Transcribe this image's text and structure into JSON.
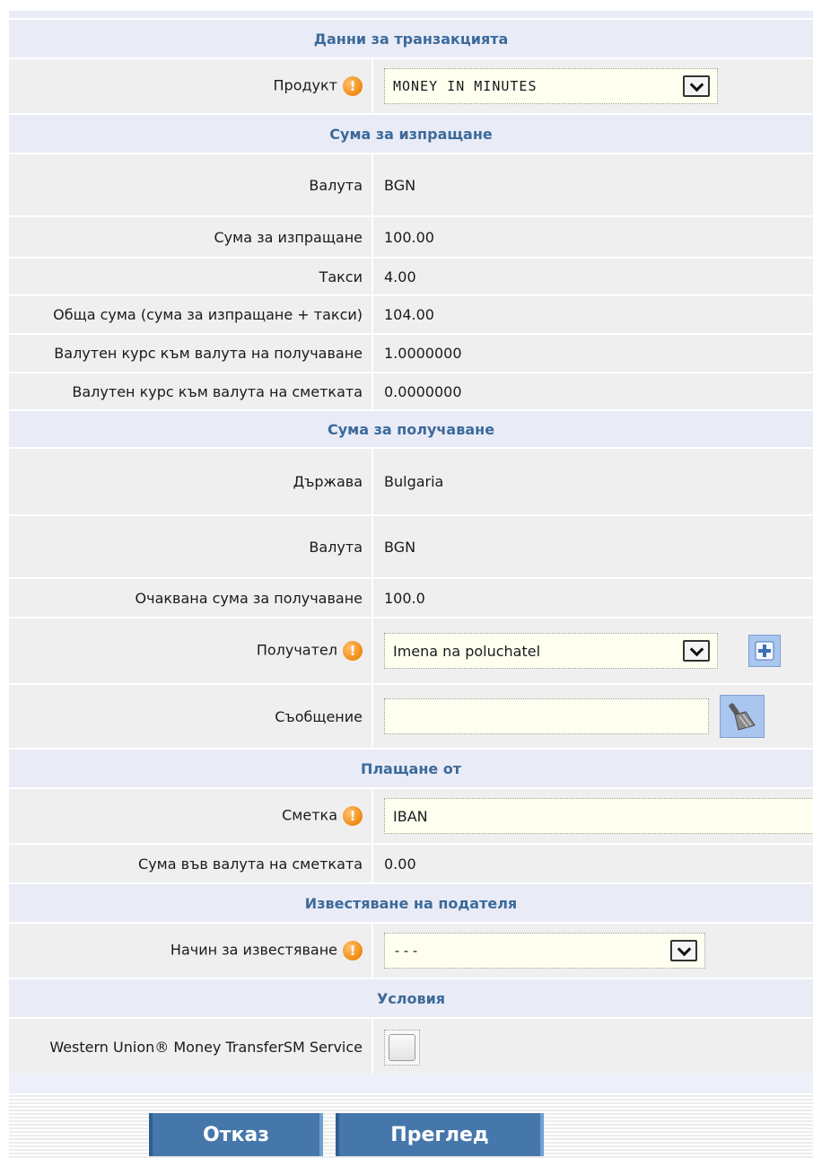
{
  "sections": {
    "transaction": "Данни за транзакцията",
    "send_amount": "Сума за изпращане",
    "receive_amount": "Сума за получаване",
    "payment_from": "Плащане от",
    "sender_notification": "Известяване на подателя",
    "terms": "Условия"
  },
  "transaction": {
    "product_label": "Продукт",
    "product_value": "MONEY IN MINUTES"
  },
  "send": {
    "currency_label": "Валута",
    "currency_value": "BGN",
    "amount_label": "Сума за изпращане",
    "amount_value": "100.00",
    "fees_label": "Такси",
    "fees_value": "4.00",
    "total_label": "Обща сума (сума за изпращане + такси)",
    "total_value": "104.00",
    "rate_receive_label": "Валутен курс към валута на получаване",
    "rate_receive_value": "1.0000000",
    "rate_account_label": "Валутен курс към валута на сметката",
    "rate_account_value": "0.0000000"
  },
  "receive": {
    "country_label": "Държава",
    "country_value": "Bulgaria",
    "currency_label": "Валута",
    "currency_value": "BGN",
    "expected_label": "Очаквана сума за получаване",
    "expected_value": "100.0",
    "recipient_label": "Получател",
    "recipient_value": "Imena na poluchatel",
    "message_label": "Съобщение",
    "message_value": ""
  },
  "payment": {
    "account_label": "Сметка",
    "account_value": "IBAN",
    "account_currency_label": "Сума във валута на сметката",
    "account_currency_value": "0.00"
  },
  "notification": {
    "method_label": "Начин за известяване",
    "method_value": "---"
  },
  "terms": {
    "service_label": "Western Union® Money TransferSM Service"
  },
  "icons": {
    "warning": "warning-icon",
    "add": "plus-icon",
    "clear": "broom-icon",
    "dropdown": "chevron-down-icon"
  },
  "colors": {
    "section_text": "#3c6a9a",
    "section_bg": "#e9ecf7",
    "row_bg": "#efefef",
    "input_bg": "#fffff0",
    "button_bg": "#4677ab",
    "warning": "#f08a10"
  },
  "buttons": {
    "cancel": "Отказ",
    "review": "Преглед"
  }
}
